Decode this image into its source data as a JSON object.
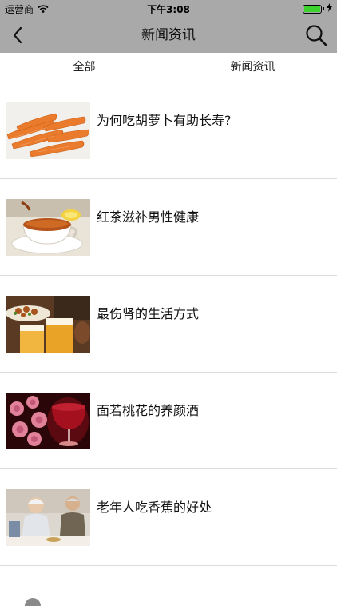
{
  "status_bar": {
    "carrier": "运营商",
    "time": "下午3:08",
    "wifi_icon": "wifi-icon",
    "battery_icon": "battery-icon"
  },
  "nav": {
    "title": "新闻资讯",
    "back_icon": "chevron-left-icon",
    "search_icon": "search-icon"
  },
  "tabs": [
    {
      "label": "全部"
    },
    {
      "label": "新闻资讯"
    }
  ],
  "articles": [
    {
      "title": "为何吃胡萝卜有助长寿?",
      "image": "carrots"
    },
    {
      "title": "红茶滋补男性健康",
      "image": "black-tea"
    },
    {
      "title": "最伤肾的生活方式",
      "image": "beer-and-food"
    },
    {
      "title": "面若桃花的养颜酒",
      "image": "roses-and-wine"
    },
    {
      "title": "老年人吃香蕉的好处",
      "image": "elderly-couple"
    }
  ],
  "colors": {
    "header_bg": "#a9a9a9",
    "battery": "#3bd22e"
  }
}
